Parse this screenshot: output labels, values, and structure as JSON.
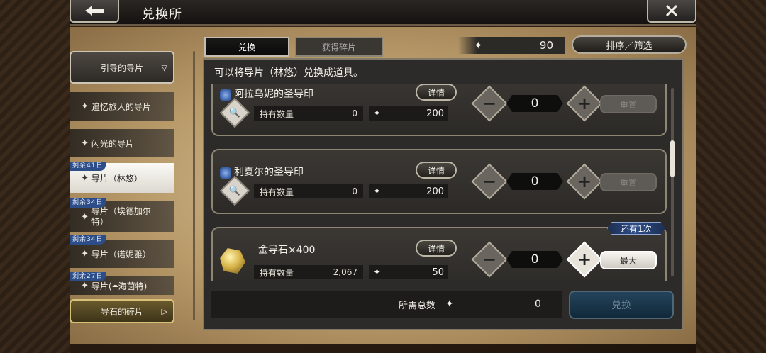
{
  "header": {
    "title": "兑换所"
  },
  "tabs": [
    {
      "label": "兑换"
    },
    {
      "label": "获得碎片"
    }
  ],
  "currency": {
    "value": "90"
  },
  "sort_label": "排序／筛选",
  "description": "可以将导片（林悠）兑换成道具。",
  "sidebar": {
    "items": [
      {
        "label": "引导的导片"
      },
      {
        "label": "追忆旅人的导片"
      },
      {
        "label": "闪光的导片"
      },
      {
        "label": "导片（林悠）",
        "badge": "剩余41日"
      },
      {
        "label": "导片（埃德加尔特）",
        "badge": "剩余34日"
      },
      {
        "label": "导片（诺妮雅）",
        "badge": "剩余34日"
      },
      {
        "label": "导片(",
        "badge": "剩余27日"
      },
      {
        "label": "海茵特)"
      },
      {
        "label": "导石的碎片"
      }
    ]
  },
  "items": [
    {
      "name": "阿拉乌妮的圣导印",
      "detail": "详情",
      "hold_label": "持有数量",
      "hold": "0",
      "cost": "200",
      "qty": "0",
      "action": "重置"
    },
    {
      "name": "利夏尔的圣导印",
      "detail": "详情",
      "hold_label": "持有数量",
      "hold": "0",
      "cost": "200",
      "qty": "0",
      "action": "重置"
    },
    {
      "name": "金导石×400",
      "detail": "详情",
      "hold_label": "持有数量",
      "hold": "2,067",
      "cost": "50",
      "qty": "0",
      "action": "最大",
      "remaining": "还有1次"
    }
  ],
  "total": {
    "label": "所需总数",
    "value": "0"
  },
  "exchange_label": "兑换"
}
